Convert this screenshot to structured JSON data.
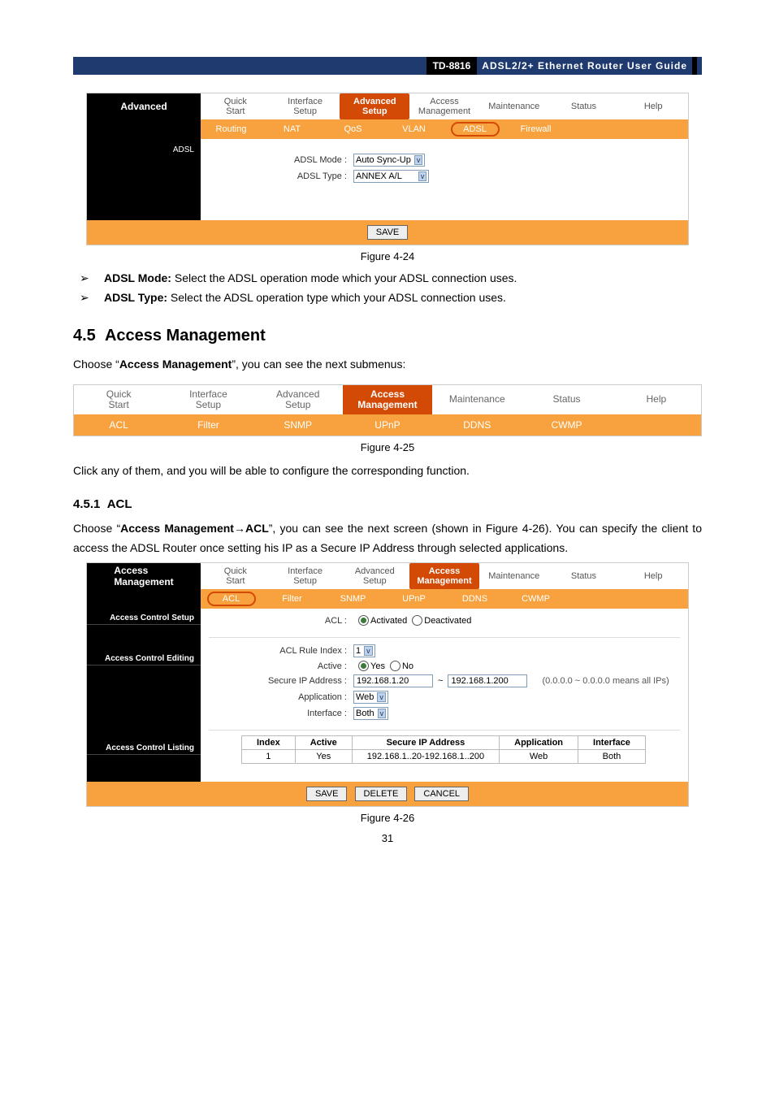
{
  "doc_header": {
    "model": "TD-8816",
    "title": "ADSL2/2+ Ethernet Router User Guide"
  },
  "fig424": {
    "black_title": "Advanced",
    "main_tabs": [
      "Quick\nStart",
      "Interface\nSetup",
      "Advanced\nSetup",
      "Access\nManagement",
      "Maintenance",
      "Status",
      "Help"
    ],
    "main_active": 2,
    "sub_tabs": [
      "Routing",
      "NAT",
      "QoS",
      "VLAN",
      "ADSL",
      "Firewall"
    ],
    "sub_active": 4,
    "side_label": "ADSL",
    "rows": {
      "mode_label": "ADSL Mode :",
      "mode_value": "Auto Sync-Up",
      "type_label": "ADSL Type :",
      "type_value": "ANNEX A/L"
    },
    "save": "SAVE",
    "caption": "Figure 4-24"
  },
  "bullets": {
    "arrow": "➢",
    "adsl_mode_b": "ADSL Mode:",
    "adsl_mode_t": " Select the ADSL operation mode which your ADSL connection uses.",
    "adsl_type_b": "ADSL Type:",
    "adsl_type_t": " Select the ADSL operation type which your ADSL connection uses."
  },
  "sect45": {
    "num": "4.5",
    "title": "Access Management",
    "p1a": "Choose “",
    "p1b": "Access Management",
    "p1c": "”, you can see the next submenus:"
  },
  "fig425": {
    "main_tabs": [
      "Quick\nStart",
      "Interface\nSetup",
      "Advanced\nSetup",
      "Access\nManagement",
      "Maintenance",
      "Status",
      "Help"
    ],
    "main_active": 3,
    "sub_tabs": [
      "ACL",
      "Filter",
      "SNMP",
      "UPnP",
      "DDNS",
      "CWMP"
    ],
    "caption": "Figure 4-25"
  },
  "p_click": "Click any of them, and you will be able to configure the corresponding function.",
  "sect451": {
    "num": "4.5.1",
    "title": "ACL",
    "p_a": "Choose “",
    "p_b": "Access Management",
    "p_arrow": "→",
    "p_c": "ACL",
    "p_d": "”, you can see the next screen (shown in Figure 4-26). You can specify the client to access the ADSL Router once setting his IP as a Secure IP Address through selected applications."
  },
  "fig426": {
    "black_title": "Access\nManagement",
    "main_tabs": [
      "Quick\nStart",
      "Interface\nSetup",
      "Advanced\nSetup",
      "Access\nManagement",
      "Maintenance",
      "Status",
      "Help"
    ],
    "main_active": 3,
    "sub_tabs": [
      "ACL",
      "Filter",
      "SNMP",
      "UPnP",
      "DDNS",
      "CWMP"
    ],
    "sub_active": 0,
    "sec1": "Access Control Setup",
    "acl_label": "ACL :",
    "acl_activated": "Activated",
    "acl_deactivated": "Deactivated",
    "sec2": "Access Control Editing",
    "rule_index_label": "ACL Rule Index :",
    "rule_index_value": "1",
    "active_label": "Active :",
    "active_yes": "Yes",
    "active_no": "No",
    "secure_label": "Secure IP Address :",
    "ip_from": "192.168.1.20",
    "ip_tilde": "~",
    "ip_to": "192.168.1.200",
    "ip_hint": "(0.0.0.0 ~ 0.0.0.0 means all IPs)",
    "app_label": "Application :",
    "app_value": "Web",
    "iface_label": "Interface :",
    "iface_value": "Both",
    "sec3": "Access Control Listing",
    "th": [
      "Index",
      "Active",
      "Secure IP Address",
      "Application",
      "Interface"
    ],
    "row1": [
      "1",
      "Yes",
      "192.168.1..20-192.168.1..200",
      "Web",
      "Both"
    ],
    "btn_save": "SAVE",
    "btn_delete": "DELETE",
    "btn_cancel": "CANCEL",
    "caption": "Figure 4-26"
  },
  "page_num": "31"
}
